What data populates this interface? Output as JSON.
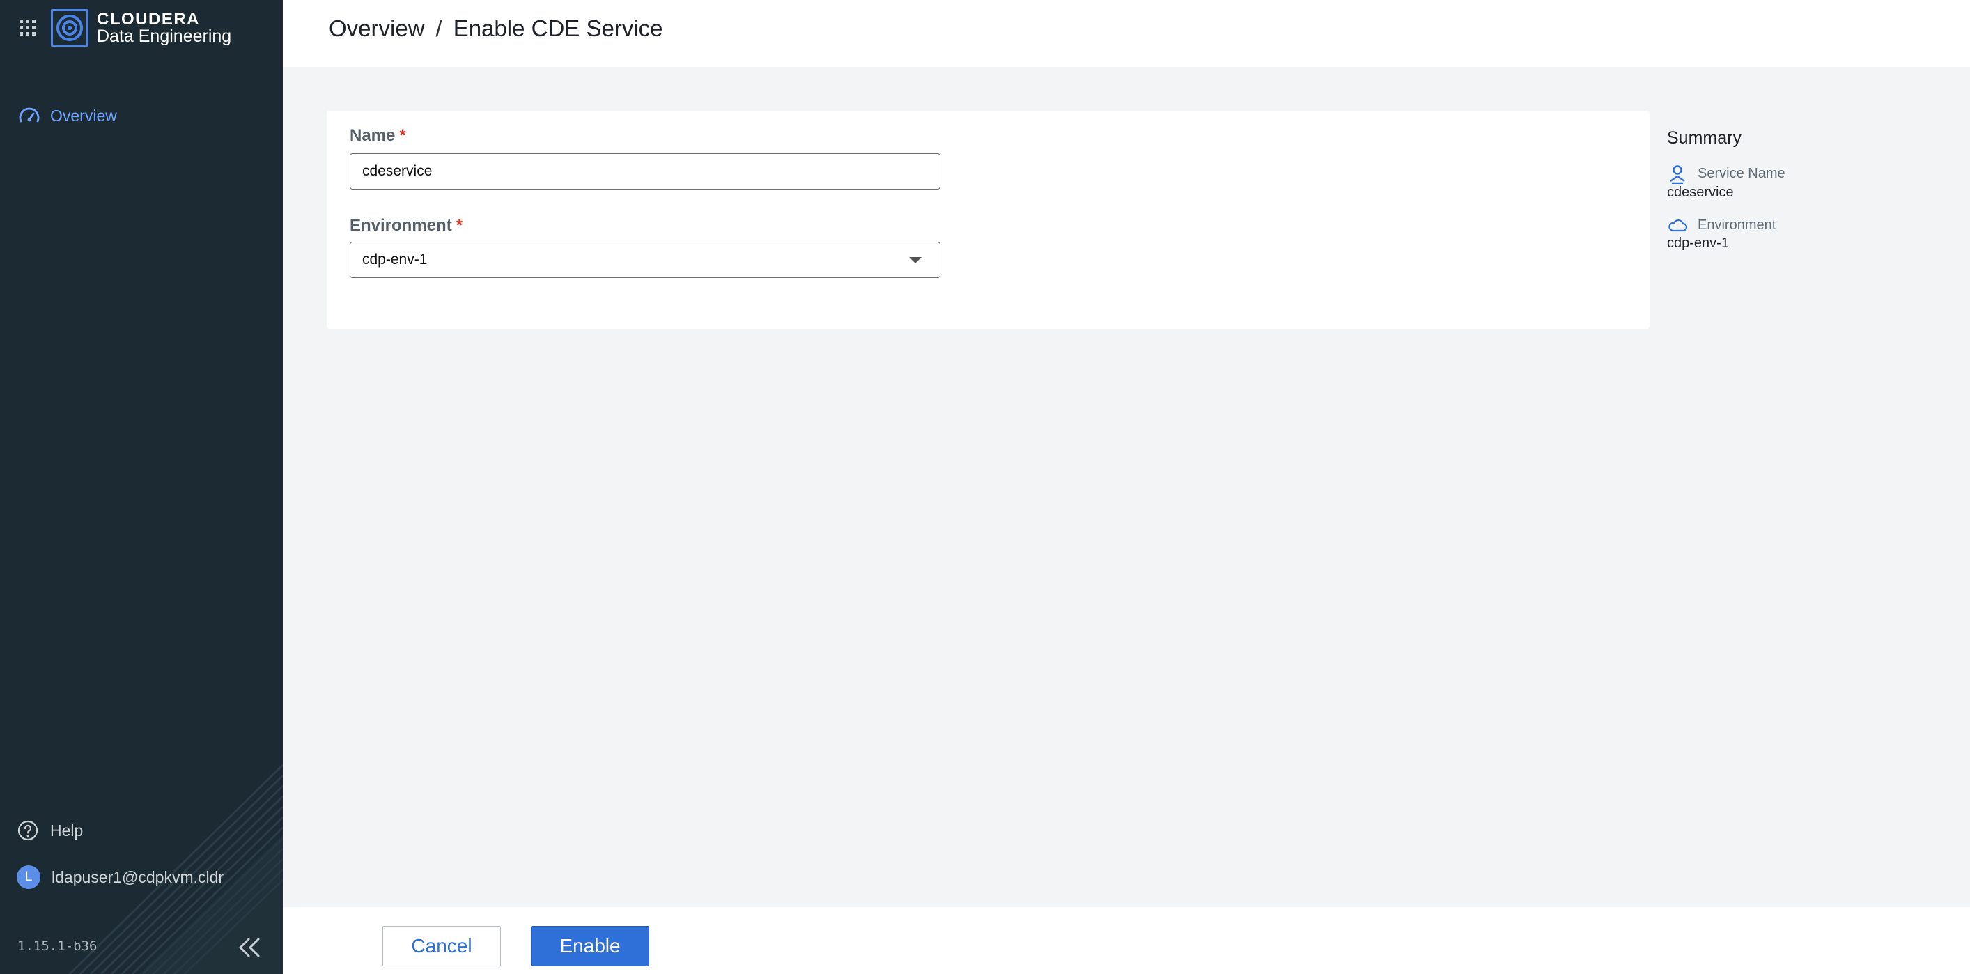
{
  "sidebar": {
    "brand_line1": "CLOUDERA",
    "brand_line2": "Data Engineering",
    "nav": [
      {
        "label": "Overview",
        "icon": "gauge-icon",
        "active": true
      }
    ],
    "help_label": "Help",
    "user_initial": "L",
    "user_label": "ldapuser1@cdpkvm.cldr",
    "version": "1.15.1-b36"
  },
  "header": {
    "breadcrumb": [
      "Overview",
      "Enable CDE Service"
    ],
    "separator": "/"
  },
  "form": {
    "name_label": "Name",
    "name_value": "cdeservice",
    "environment_label": "Environment",
    "environment_value": "cdp-env-1",
    "required_marker": "*"
  },
  "summary": {
    "title": "Summary",
    "service_name_key": "Service Name",
    "service_name_value": "cdeservice",
    "environment_key": "Environment",
    "environment_value": "cdp-env-1"
  },
  "footer": {
    "cancel_label": "Cancel",
    "enable_label": "Enable"
  },
  "colors": {
    "sidebar_bg": "#1c2b33",
    "accent": "#2f6fd8",
    "nav_active": "#6fa4ff",
    "required": "#d93025"
  }
}
